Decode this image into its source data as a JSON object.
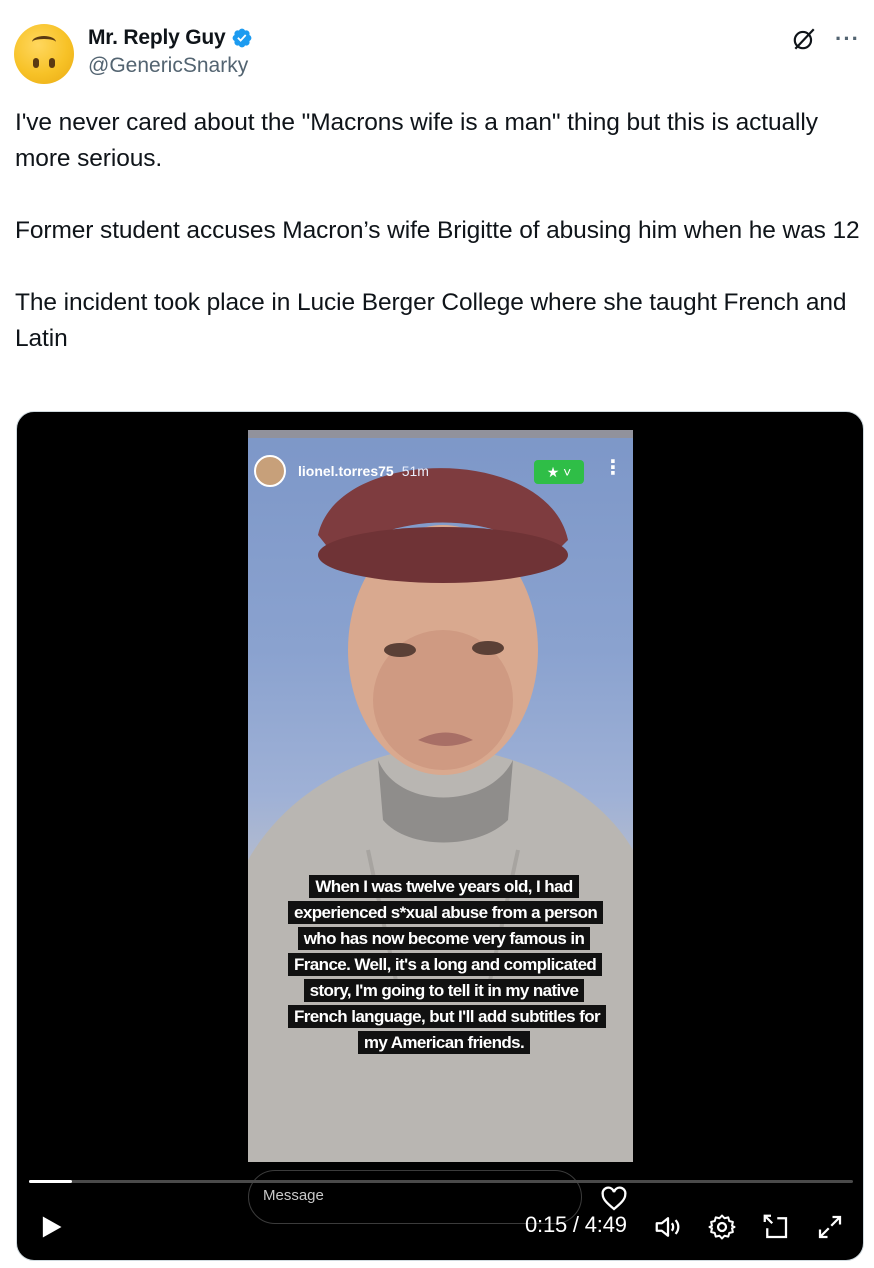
{
  "header": {
    "display_name": "Mr. Reply Guy",
    "handle": "@GenericSnarky"
  },
  "tweet": {
    "paragraphs": [
      "I've never cared about the \"Macrons wife is a man\" thing but this is actually more serious.",
      "Former student accuses Macron’s wife Brigitte of abusing him when he was 12",
      "The incident took place in Lucie Berger College where she taught French and Latin"
    ]
  },
  "story": {
    "username": "lionel.torres75",
    "time_ago": "51m",
    "caption": "When I was twelve years old, I had experienced s*xual abuse from a person who has now become very famous in France. Well, it's a long and complicated story, I'm going to tell it in my native French language, but I'll add subtitles for my American friends.",
    "message_placeholder": "Message"
  },
  "player": {
    "current_time": "0:15",
    "duration": "4:49",
    "time_display": "0:15 / 4:49",
    "progress_fraction": 0.052
  },
  "colors": {
    "verified_blue": "#1d9bf0",
    "text_primary": "#0f1419",
    "text_secondary": "#536471",
    "close_friends_green": "#2fbe47"
  },
  "icons": [
    "grok-icon",
    "more-icon",
    "verified-badge-icon",
    "play-icon",
    "volume-icon",
    "settings-icon",
    "picture-in-picture-icon",
    "fullscreen-icon",
    "heart-icon",
    "star-icon"
  ]
}
